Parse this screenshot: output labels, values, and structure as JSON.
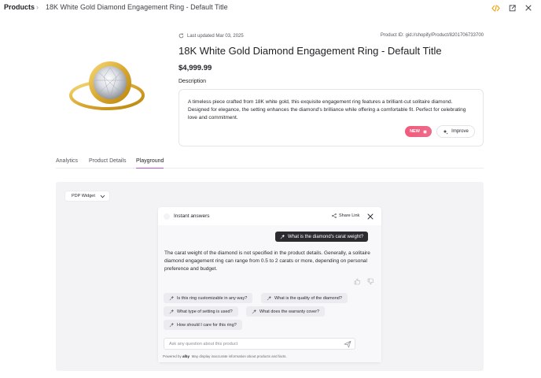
{
  "breadcrumb": {
    "root": "Products",
    "separator": "›",
    "current": "18K White Gold Diamond Engagement Ring - Default Title"
  },
  "toolbar": {
    "icons": [
      "code-icon",
      "external-link-icon",
      "close-icon"
    ],
    "accent": "#f59e0b"
  },
  "product": {
    "last_updated": "Last updated Mar 03, 2025",
    "id_label": "Product ID: gid://shopify/Product/8201706733700",
    "title": "18K White Gold Diamond Engagement Ring - Default Title",
    "price": "$4,999.99",
    "description_label": "Description",
    "description": "A timeless piece crafted from 18K white gold, this exquisite engagement ring features a brilliant-cut solitaire diamond. Designed for elegance, the setting enhances the diamond's brilliance while offering a comfortable fit. Perfect for celebrating love and commitment.",
    "badge": "NEW",
    "improve_label": "Improve"
  },
  "tabs": [
    {
      "label": "Analytics",
      "active": false
    },
    {
      "label": "Product Details",
      "active": false
    },
    {
      "label": "Playground",
      "active": true
    }
  ],
  "playground": {
    "widget_select": "PDP Widget",
    "widget": {
      "title": "Instant answers",
      "share_label": "Share Link",
      "question": "What is the diamond's carat weight?",
      "answer": "The carat weight of the diamond is not specified in the product details. Generally, a solitaire diamond engagement ring can range from 0.5 to 2 carats or more, depending on personal preference and budget.",
      "suggestions": [
        "Is this ring customizable in any way?",
        "What is the quality of the diamond?",
        "What type of setting is used?",
        "What does the warranty cover?",
        "How should I care for this ring?"
      ],
      "input_placeholder": "Ask any question about this product",
      "powered_prefix": "Powered by",
      "powered_brand": "alby",
      "disclaimer": "May display inaccurate information about products and facts."
    }
  },
  "colors": {
    "tab_active": "#b15ad1",
    "badge": "#f25a7a",
    "question_bubble": "#2b2b30",
    "playground_bg": "#f3f3f6"
  }
}
